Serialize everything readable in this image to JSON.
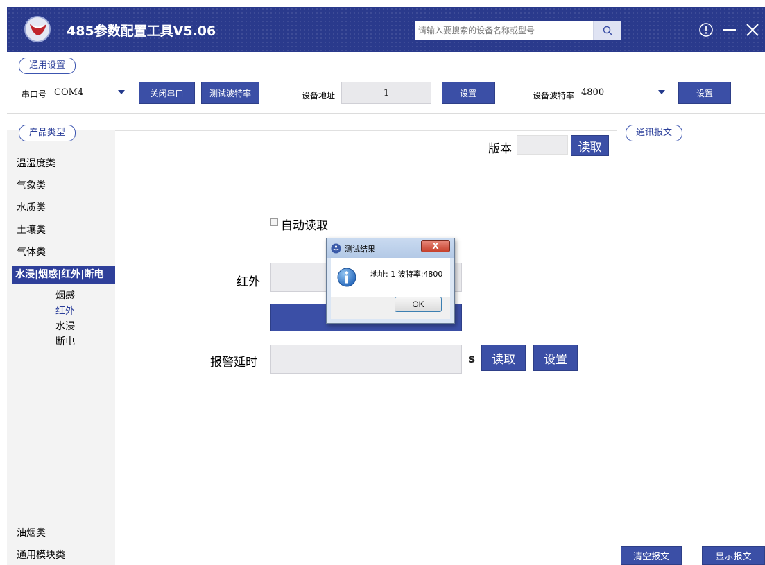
{
  "window": {
    "title": "485参数配置工具V5.06",
    "search_placeholder": "请输入要搜索的设备名称或型号"
  },
  "general": {
    "group_label": "通用设置",
    "port_label": "串口号",
    "port_value": "COM4",
    "close_port_label": "关闭串口",
    "test_baud_label": "测试波特率",
    "address_label": "设备地址",
    "address_value": "1",
    "set_address_label": "设置",
    "baud_label": "设备波特率",
    "baud_value": "4800",
    "set_baud_label": "设置"
  },
  "product": {
    "group_label": "产品类型",
    "categories": [
      "温湿度类",
      "气象类",
      "水质类",
      "土壤类",
      "气体类"
    ],
    "selected_category": "水浸|烟感|红外|断电",
    "sub_items": [
      "烟感",
      "红外",
      "水浸",
      "断电"
    ],
    "active_sub_item": "红外",
    "bottom_categories": [
      "油烟类",
      "通用模块类"
    ]
  },
  "main": {
    "version_label": "版本",
    "version_value": "",
    "read_version_label": "读取",
    "auto_read_label": "自动读取",
    "auto_read_checked": false,
    "infrared_label": "红外",
    "infrared_value": "",
    "alarm_delay_label": "报警延时",
    "alarm_delay_value": "",
    "alarm_delay_unit": "s",
    "read_alarm_label": "读取",
    "set_alarm_label": "设置"
  },
  "comm": {
    "group_label": "通讯报文",
    "clear_label": "清空报文",
    "show_label": "显示报文"
  },
  "dialog": {
    "title": "测试结果",
    "message": "地址: 1  波特率:4800",
    "ok_label": "OK",
    "close_label": "X"
  },
  "colors": {
    "brand": "#2a3a8c",
    "button": "#3b4fa6",
    "selected": "#2e3f9a"
  }
}
